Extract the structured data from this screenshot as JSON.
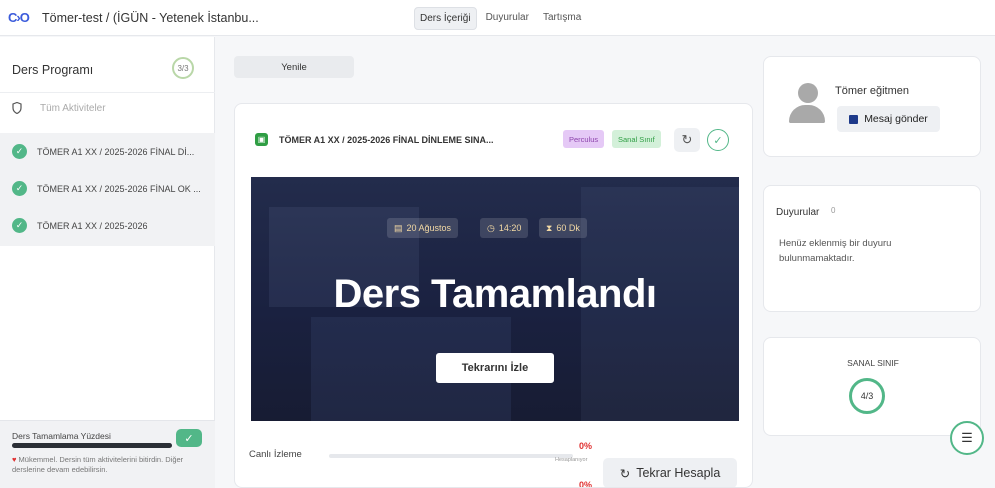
{
  "header": {
    "logo": "C›O",
    "course_title": "Tömer-test / (İGÜN - Yetenek İstanbu...",
    "tabs": [
      {
        "label": "Ders İçeriği",
        "active": true
      },
      {
        "label": "Duyurular",
        "active": false
      },
      {
        "label": "Tartışma",
        "active": false
      }
    ]
  },
  "sidebar": {
    "title": "Ders Programı",
    "count": "3/3",
    "filter_label": "Tüm Aktiviteler",
    "items": [
      {
        "label": "TÖMER A1 XX / 2025-2026 FİNAL Dİ..."
      },
      {
        "label": "TÖMER A1 XX / 2025-2026 FİNAL OK ..."
      },
      {
        "label": "TÖMER A1 XX / 2025-2026"
      }
    ],
    "footer": {
      "title": "Ders Tamamlama Yüzdesi",
      "progress_fraction": 1.0,
      "message": "Mükemmel. Dersin tüm aktivitelerini bitirdin. Diğer derslerine devam edebilirsin."
    }
  },
  "main": {
    "refresh_label": "Yenile",
    "card": {
      "title": "TÖMER A1 XX / 2025-2026 FİNAL DİNLEME SINA...",
      "badges": [
        "Perculus",
        "Sanal Sınıf"
      ],
      "date": "20 Ağustos",
      "time": "14:20",
      "duration": "60 Dk",
      "banner_title": "Ders Tamamlandı",
      "watch_label": "Tekrarını İzle",
      "live_label": "Canlı İzleme",
      "live_percent": "0%",
      "live_sub": "Hesaplanıyor",
      "second_percent": "0%",
      "recalc_label": "Tekrar Hesapla"
    }
  },
  "right": {
    "instructor": {
      "name": "Tömer eğitmen",
      "message_label": "Mesaj gönder"
    },
    "announcements": {
      "title": "Duyurular",
      "count": "0",
      "empty_text": "Henüz eklenmiş bir duyuru bulunmamaktadır."
    },
    "virtual_class": {
      "title": "SANAL SINIF",
      "value": "4/3"
    }
  },
  "colors": {
    "accent_green": "#52b788",
    "banner_bg": "#1e2546",
    "alert_red": "#e03131"
  },
  "icons": [
    "logo-icon",
    "shield-icon",
    "check-icon",
    "calendar-icon",
    "clock-icon",
    "hourglass-icon",
    "refresh-icon",
    "flag-icon",
    "settings-sliders-icon",
    "heart-icon",
    "avatar-icon"
  ]
}
